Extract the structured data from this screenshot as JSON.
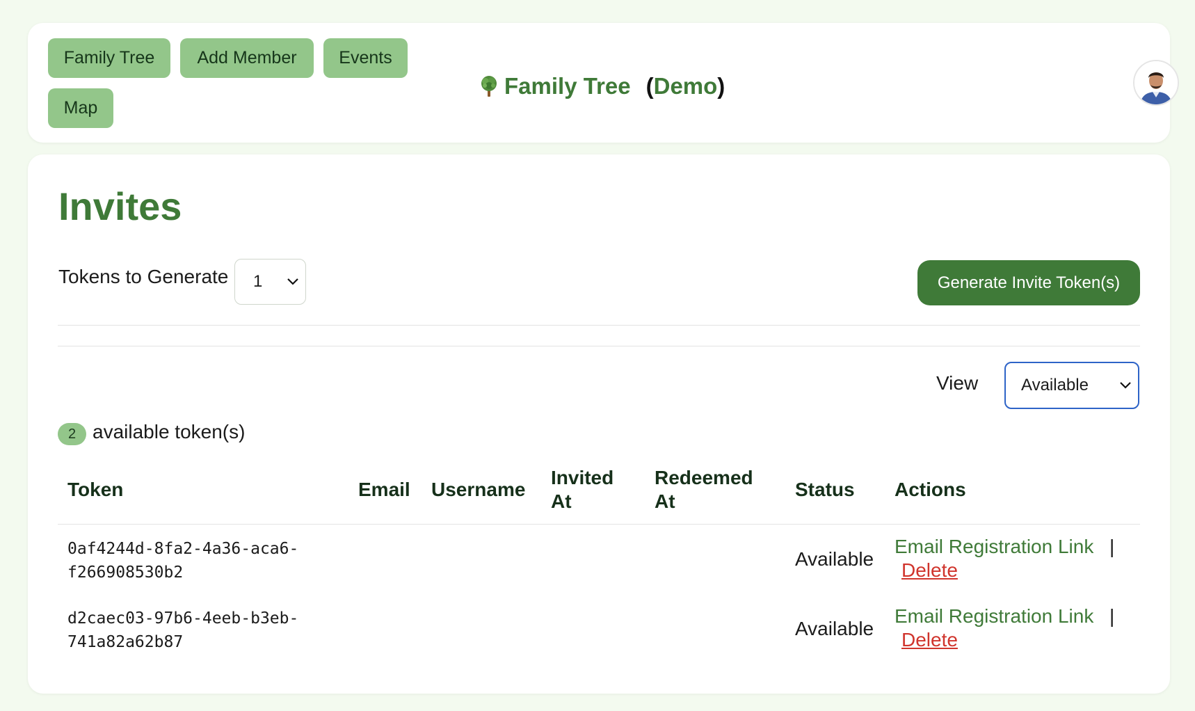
{
  "nav": {
    "items": [
      {
        "label": "Family Tree"
      },
      {
        "label": "Add Member"
      },
      {
        "label": "Events"
      },
      {
        "label": "Map"
      }
    ]
  },
  "brand": {
    "title": "Family Tree",
    "demo_open": "(",
    "demo": "Demo",
    "demo_close": ")",
    "icon": "tree-icon"
  },
  "user": {
    "avatar_icon": "avatar"
  },
  "page": {
    "title": "Invites"
  },
  "generate": {
    "label": "Tokens to Generate",
    "selected": "1",
    "button_label": "Generate Invite Token(s)"
  },
  "view": {
    "label": "View",
    "selected": "Available"
  },
  "summary": {
    "count": "2",
    "text": "available token(s)"
  },
  "table": {
    "headers": [
      {
        "line1": "Token",
        "line2": ""
      },
      {
        "line1": "Email",
        "line2": ""
      },
      {
        "line1": "Username",
        "line2": ""
      },
      {
        "line1": "Invited",
        "line2": "At"
      },
      {
        "line1": "Redeemed",
        "line2": "At"
      },
      {
        "line1": "Status",
        "line2": ""
      },
      {
        "line1": "Actions",
        "line2": ""
      }
    ],
    "rows": [
      {
        "token_line1": "0af4244d-8fa2-4a36-aca6-",
        "token_line2": "f266908530b2",
        "email": "",
        "username": "",
        "invited_at": "",
        "redeemed_at": "",
        "status": "Available",
        "email_link": "Email Registration Link",
        "separator": "|",
        "delete_link": "Delete"
      },
      {
        "token_line1": "d2caec03-97b6-4eeb-b3eb-",
        "token_line2": "741a82a62b87",
        "email": "",
        "username": "",
        "invited_at": "",
        "redeemed_at": "",
        "status": "Available",
        "email_link": "Email Registration Link",
        "separator": "|",
        "delete_link": "Delete"
      }
    ]
  },
  "colors": {
    "background": "#f3faef",
    "nav_button": "#93c68a",
    "accent_green": "#3f7a38",
    "delete_red": "#d0342c",
    "focus_blue": "#2d63c7"
  }
}
